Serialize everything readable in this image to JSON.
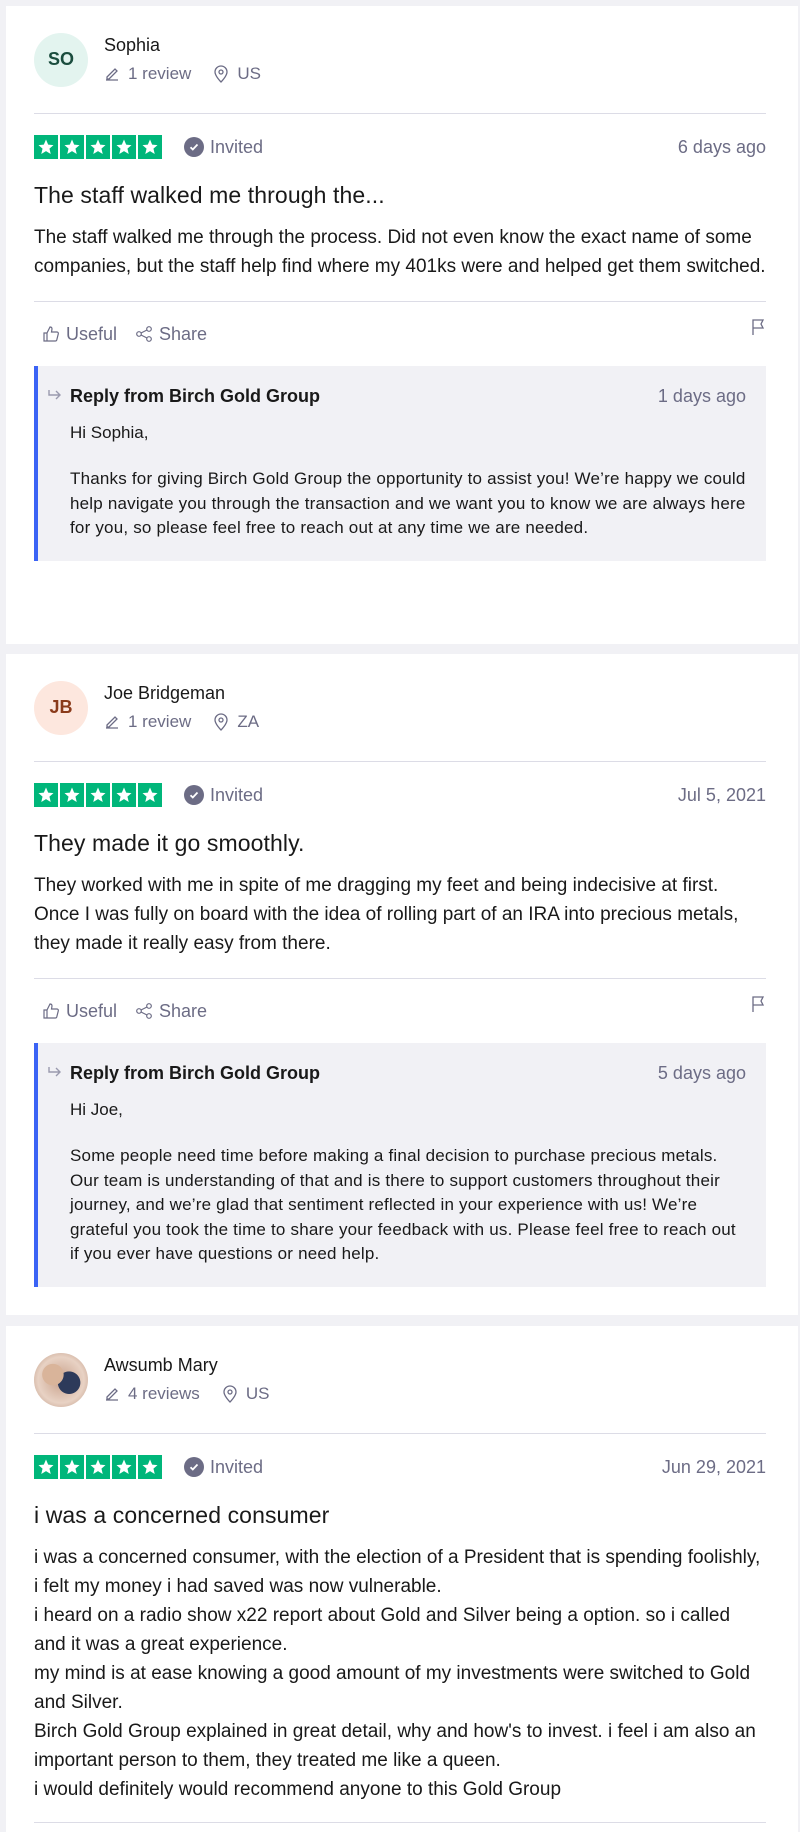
{
  "reviews": [
    {
      "initials": "SO",
      "name": "Sophia",
      "review_count": "1 review",
      "country": "US",
      "badge": "Invited",
      "date": "6 days ago",
      "title": "The staff walked me through the...",
      "text": [
        "The staff walked me through the process. Did not even know the exact name of some companies, but the staff help find where my 401ks were and helped get them switched."
      ],
      "useful_label": "Useful",
      "share_label": "Share",
      "reply": {
        "from": "Reply from Birch Gold Group",
        "date": "1 days ago",
        "greeting": "Hi Sophia,",
        "text": "Thanks for giving Birch Gold Group the opportunity to assist you! We’re happy we could help navigate you through the transaction and we want you to know we are always here for you, so please feel free to reach out at any time we are needed."
      }
    },
    {
      "initials": "JB",
      "name": "Joe Bridgeman",
      "review_count": "1 review",
      "country": "ZA",
      "badge": "Invited",
      "date": "Jul 5, 2021",
      "title": "They made it go smoothly.",
      "text": [
        "They worked with me in spite of me dragging my feet and being indecisive at first. Once I was fully on board with the idea of rolling part of an IRA into precious metals, they made it really easy from there."
      ],
      "useful_label": "Useful",
      "share_label": "Share",
      "reply": {
        "from": "Reply from Birch Gold Group",
        "date": "5 days ago",
        "greeting": "Hi Joe,",
        "text": "Some people need time before making a final decision to purchase precious metals. Our team is understanding of that and is there to support customers throughout their journey, and we’re glad that sentiment reflected in your experience with us! We’re grateful you took the time to share your feedback with us. Please feel free to reach out if you ever have questions or need help."
      }
    },
    {
      "initials": "",
      "name": "Awsumb Mary",
      "review_count": "4 reviews",
      "country": "US",
      "badge": "Invited",
      "date": "Jun 29, 2021",
      "title": "i was a concerned consumer",
      "text": [
        "i was a concerned consumer, with the election of a President that is spending foolishly, i felt my money i had saved was now vulnerable.",
        "i heard on a radio show x22 report about Gold and Silver being a option. so i called and it was a great experience.",
        "my mind is at ease knowing a good amount of my investments were switched to Gold and Silver.",
        "Birch Gold Group explained in great detail, why and how's to invest. i feel i am also an important person to them, they treated me like a queen.",
        "i would definitely would recommend anyone to this Gold Group"
      ]
    }
  ],
  "colors": {
    "star_green": "#00b67a",
    "reply_accent": "#3b63f5",
    "muted": "#6c6c85"
  },
  "icons": [
    "pencil-icon",
    "location-pin-icon",
    "star-icon",
    "check-circle-icon",
    "thumbs-up-icon",
    "share-icon",
    "flag-icon",
    "reply-arrow-icon"
  ]
}
